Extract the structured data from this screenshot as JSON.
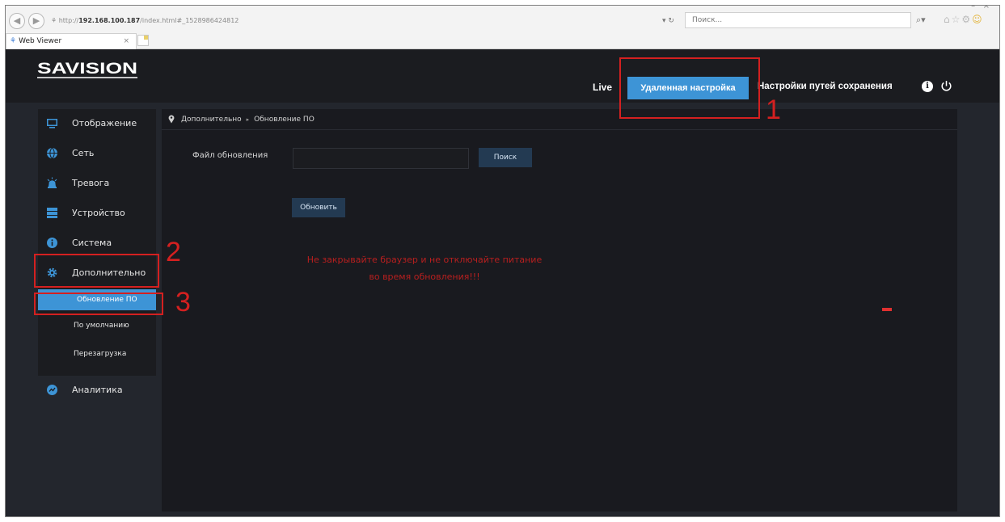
{
  "browser": {
    "address_prefix": "http://",
    "address_host": "192.168.100.187",
    "address_rest": "/index.html#_1528986424812",
    "address_controls": "▾ ↻",
    "search_placeholder": "Поиск...",
    "tab_title": "Web Viewer",
    "tab_close": "×"
  },
  "header": {
    "logo_text": "SAVISION",
    "nav_live": "Live",
    "nav_remote": "Удаленная настройка",
    "nav_path": "Настройки путей сохранения",
    "info_glyph": "i"
  },
  "sidebar": {
    "items": [
      {
        "label": "Отображение",
        "icon": "display-icon"
      },
      {
        "label": "Сеть",
        "icon": "network-icon"
      },
      {
        "label": "Тревога",
        "icon": "alarm-icon"
      },
      {
        "label": "Устройство",
        "icon": "device-icon"
      },
      {
        "label": "Система",
        "icon": "info-icon"
      },
      {
        "label": "Дополнительно",
        "icon": "gear-icon"
      }
    ],
    "sub_items": [
      {
        "label": "Обновление ПО",
        "active": true
      },
      {
        "label": "По умолчанию",
        "active": false
      },
      {
        "label": "Перезагрузка",
        "active": false
      }
    ],
    "analytics": {
      "label": "Аналитика",
      "icon": "analytics-icon"
    }
  },
  "content": {
    "breadcrumb": [
      "Дополнительно",
      "Обновление ПО"
    ],
    "breadcrumb_sep": "▸",
    "file_label": "Файл обновления",
    "file_value": "",
    "search_button": "Поиск",
    "update_button": "Обновить",
    "warning_line1": "Не закрывайте браузер и не отключайте питание",
    "warning_line2": "во время обновления!!!"
  },
  "annotations": [
    "1",
    "2",
    "3"
  ],
  "colors": {
    "accent": "#3d94d6",
    "header_bg": "#1b1c20",
    "page_bg": "#23262d",
    "warning": "#b81f1f",
    "annotation": "#d42020"
  }
}
